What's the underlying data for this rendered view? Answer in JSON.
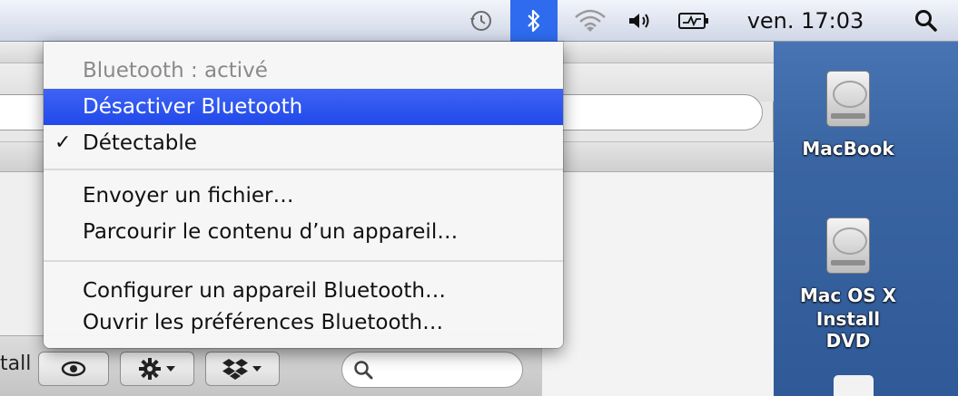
{
  "menubar": {
    "time_machine_icon": "clock-arrow",
    "bluetooth_icon": "bluetooth",
    "wifi_icon": "wifi",
    "volume_icon": "speaker",
    "battery_icon": "battery-charging",
    "clock": "ven. 17:03",
    "spotlight_icon": "magnifier"
  },
  "bluetooth_menu": {
    "status": "Bluetooth : activé",
    "items": [
      {
        "label": "Désactiver Bluetooth"
      },
      {
        "label": "Détectable"
      },
      {
        "label": "Envoyer un fichier…"
      },
      {
        "label": "Parcourir le contenu d’un appareil…"
      },
      {
        "label": "Configurer un appareil Bluetooth…"
      },
      {
        "label": "Ouvrir les préférences Bluetooth…"
      }
    ],
    "checkmark": "✓"
  },
  "finder": {
    "install_fragment": "tall"
  },
  "desktop": {
    "disks": [
      {
        "line1": "MacBook",
        "line2": ""
      },
      {
        "line1": "Mac OS X",
        "line2": "Install DVD"
      }
    ]
  },
  "colors": {
    "highlight": "#2e5ef0",
    "desktop": "#3a65a3"
  }
}
